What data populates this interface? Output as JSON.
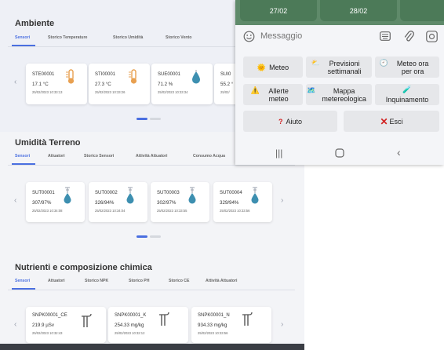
{
  "ambiente": {
    "title": "Ambiente",
    "tabs": [
      "Sensori",
      "Storico Temperature",
      "Storico Umidità",
      "Storico Vento"
    ],
    "cards": [
      {
        "code": "STE00001",
        "value": "17.1 °C",
        "date": "25/02/2023 10:33:13",
        "icon": "thermometer-icon"
      },
      {
        "code": "STI00001",
        "value": "27.3 °C",
        "date": "25/02/2023 10:33:26",
        "icon": "thermometer-icon"
      },
      {
        "code": "SUE00001",
        "value": "71.2 %",
        "date": "25/02/2023 10:33:34",
        "icon": "humidity-drop-icon"
      },
      {
        "code": "SUI0",
        "value": "55.2 °",
        "date": "25/02/",
        "icon": "humidity-drop-icon"
      }
    ]
  },
  "umidita": {
    "title": "Umidità Terreno",
    "tabs": [
      "Sensori",
      "Attuatori",
      "Storico Sensori",
      "Attività Attuatori",
      "Consumo Acqua"
    ],
    "cards": [
      {
        "code": "SUT00001",
        "value": "307/97%",
        "date": "25/02/2023 10:34:08",
        "icon": "soil-moisture-icon"
      },
      {
        "code": "SUT00002",
        "value": "326/94%",
        "date": "25/02/2023 10:34:04",
        "icon": "soil-moisture-icon"
      },
      {
        "code": "SUT00003",
        "value": "302/97%",
        "date": "25/02/2023 10:33:55",
        "icon": "soil-moisture-icon"
      },
      {
        "code": "SUT00004",
        "value": "329/94%",
        "date": "25/02/2023 10:33:56",
        "icon": "soil-moisture-icon"
      }
    ]
  },
  "nutrienti": {
    "title": "Nutrienti e composizione chimica",
    "tabs": [
      "Sensori",
      "Attuatori",
      "Storico NPK",
      "Storico PH",
      "Storico CE",
      "Attività Attuatori"
    ],
    "cards": [
      {
        "code": "SNPK00001_CE",
        "value": "219.9 µSv",
        "date": "25/02/2023 10:32:43",
        "icon": "probe-icon"
      },
      {
        "code": "SNPK00001_K",
        "value": "254.33 mg/kg",
        "date": "25/02/2023 10:32:12",
        "icon": "probe-icon"
      },
      {
        "code": "SNPK00001_N",
        "value": "934.33 mg/kg",
        "date": "25/02/2023 10:33:56",
        "icon": "probe-icon"
      }
    ]
  },
  "chat": {
    "dates": [
      "27/02",
      "28/02"
    ],
    "placeholder": "Messaggio",
    "keyboard": {
      "meteo": "Meteo",
      "previsioni": "Previsioni settimanali",
      "meteo_ora": "Meteo ora per ora",
      "allerte": "Allerte meteo",
      "mappa": "Mappa metereologica",
      "inquinamento": "Inquinamento",
      "aiuto": "Aiuto",
      "esci": "Esci"
    }
  },
  "colors": {
    "accent": "#4a6fe0",
    "chat_header": "#5f8a6a",
    "date_button": "#4c7a58",
    "thermometer": "#e8a050",
    "drop": "#3d8fb0",
    "probe": "#555555"
  }
}
